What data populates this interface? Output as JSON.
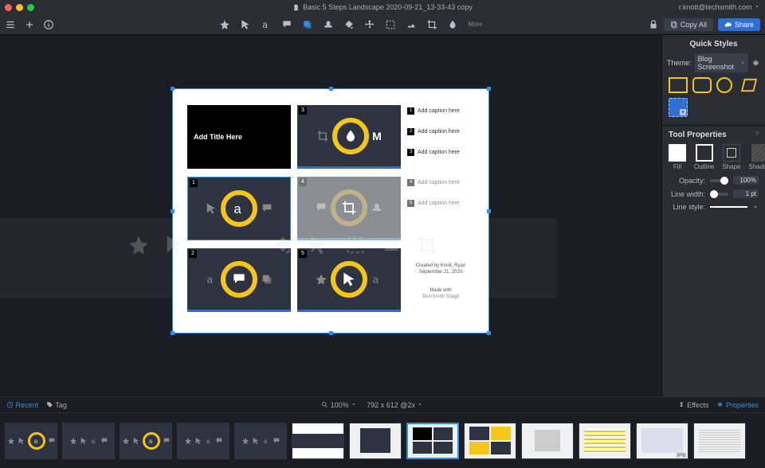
{
  "title_bar": {
    "doc_name": "Basic 5 Steps Landscape 2020-09-21_13-33-43 copy",
    "account": "r.knott@techsmith.com"
  },
  "toolbar": {
    "more": "More",
    "copy_all": "Copy All",
    "share": "Share"
  },
  "quick_styles": {
    "title": "Quick Styles",
    "theme_label": "Theme:",
    "theme_value": "Blog Screenshot"
  },
  "tool_props": {
    "title": "Tool Properties",
    "tabs": {
      "fill": "Fill",
      "outline": "Outline",
      "shape": "Shape",
      "shadow": "Shadow"
    },
    "opacity_label": "Opacity:",
    "opacity_value": "100%",
    "linewidth_label": "Line width:",
    "linewidth_value": "1 pt",
    "linestyle_label": "Line style:"
  },
  "template": {
    "title_placeholder": "Add Title Here",
    "caption_placeholder": "Add caption here",
    "footer_by": "Created by Knott, Ryan",
    "footer_date": "September 21, 2020",
    "footer_made": "Made with",
    "footer_brand": "TechSmith Snagit"
  },
  "statusbar": {
    "recent": "Recent",
    "tag": "Tag",
    "zoom": "100%",
    "dims": "792 x 612 @2x",
    "effects": "Effects",
    "properties": "Properties"
  },
  "tray": {
    "png": "png"
  }
}
